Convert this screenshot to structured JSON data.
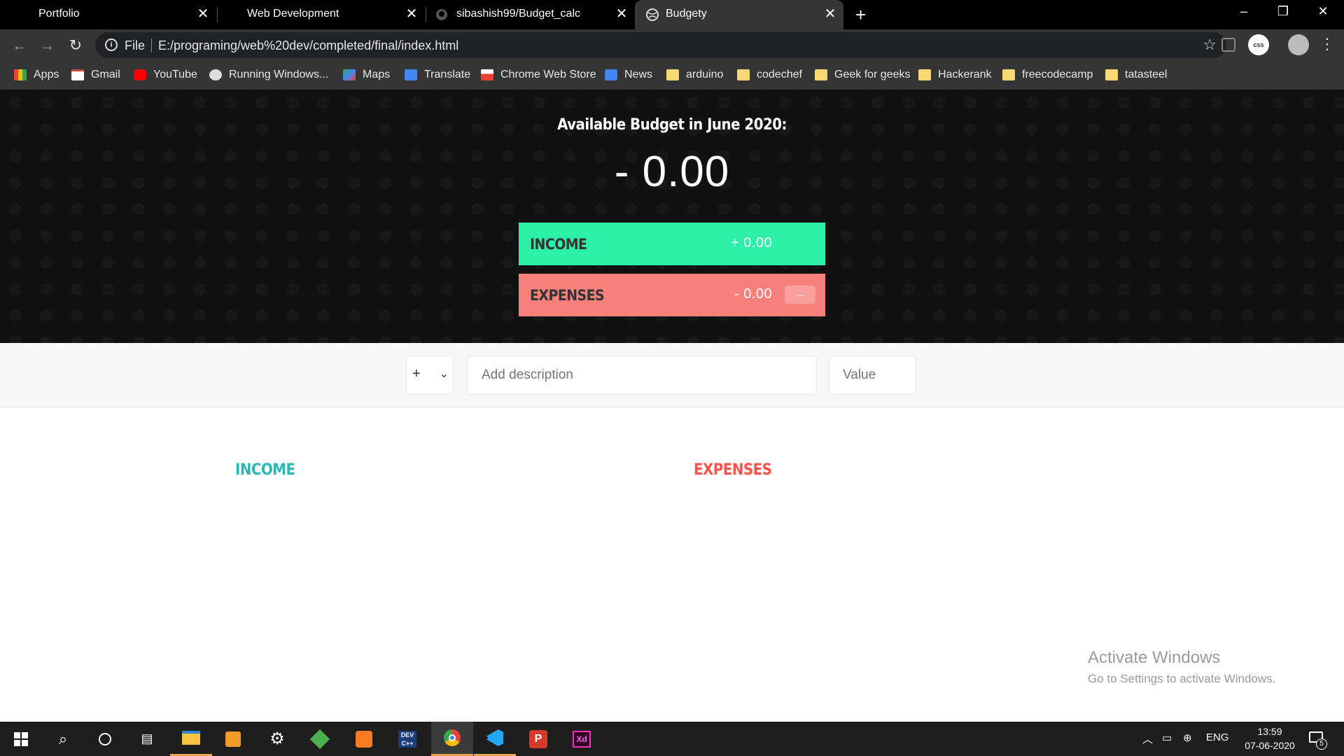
{
  "tabs": [
    {
      "title": "Portfolio",
      "close": "✕"
    },
    {
      "title": "Web Development",
      "close": "✕"
    },
    {
      "title": "sibashish99/Budget_calc",
      "close": "✕"
    },
    {
      "title": "Budgety",
      "close": "✕",
      "active": true
    }
  ],
  "window_controls": {
    "minimize": "–",
    "restore": "❐",
    "close": "✕",
    "new_tab": "+"
  },
  "address": {
    "scheme_label": "File",
    "url": "E:/programing/web%20dev/completed/final/index.html"
  },
  "bookmarks": [
    {
      "label": "Apps",
      "icon": "apps-grid-icon"
    },
    {
      "label": "Gmail",
      "icon": "gmail-icon"
    },
    {
      "label": "YouTube",
      "icon": "youtube-icon"
    },
    {
      "label": "Running Windows...",
      "icon": "globe-icon"
    },
    {
      "label": "Maps",
      "icon": "maps-icon"
    },
    {
      "label": "Translate",
      "icon": "translate-icon"
    },
    {
      "label": "Chrome Web Store",
      "icon": "web-store-icon"
    },
    {
      "label": "News",
      "icon": "news-icon"
    },
    {
      "label": "arduino",
      "icon": "folder-icon"
    },
    {
      "label": "codechef",
      "icon": "folder-icon"
    },
    {
      "label": "Geek for geeks",
      "icon": "folder-icon"
    },
    {
      "label": "Hackerank",
      "icon": "folder-icon"
    },
    {
      "label": "freecodecamp",
      "icon": "folder-icon"
    },
    {
      "label": "tatasteel",
      "icon": "folder-icon"
    }
  ],
  "budget": {
    "title": "Available Budget in June 2020:",
    "value": "- 0.00",
    "income_label": "INCOME",
    "income_value": "+ 0.00",
    "expenses_label": "EXPENSES",
    "expenses_value": "- 0.00",
    "expenses_percentage": "---"
  },
  "add_form": {
    "type_value": "+",
    "description_placeholder": "Add description",
    "value_placeholder": "Value"
  },
  "lists": {
    "income_title": "INCOME",
    "expenses_title": "EXPENSES"
  },
  "watermark": {
    "line1": "Activate Windows",
    "line2": "Go to Settings to activate Windows."
  },
  "tray": {
    "language": "ENG",
    "time": "13:59",
    "date": "07-06-2020",
    "notifications": "5"
  },
  "colors": {
    "income": "#28b9b5",
    "expenses": "#ff5049",
    "income_card": "#2df0a8",
    "expense_card": "#f7807b"
  }
}
